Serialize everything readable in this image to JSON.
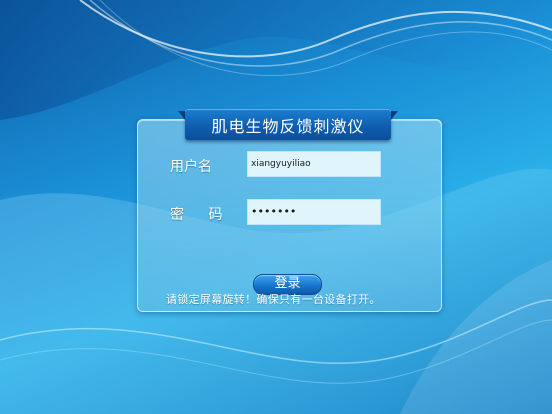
{
  "app": {
    "title": "肌电生物反馈刺激仪"
  },
  "form": {
    "username_label": "用户名",
    "username_value": "xiangyuyiliao",
    "password_label": "密 码",
    "password_value": "•••••••"
  },
  "actions": {
    "login_label": "登录"
  },
  "notice": {
    "text": "请锁定屏幕旋转！确保只有一台设备打开。"
  }
}
